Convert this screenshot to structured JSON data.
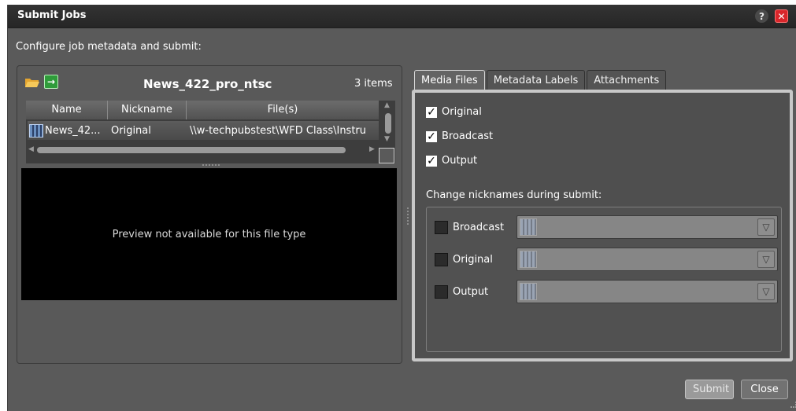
{
  "dialog": {
    "title": "Submit Jobs",
    "help_glyph": "?",
    "close_glyph": "✕",
    "subtitle": "Configure job metadata and submit:"
  },
  "left_panel": {
    "bin_name": "News_422_pro_ntsc",
    "item_count": "3 items",
    "columns": [
      "Name",
      "Nickname",
      "File(s)"
    ],
    "rows": [
      {
        "name": "News_42...",
        "nickname": "Original",
        "files": "\\\\w-techpubstest\\WFD Class\\Instru"
      }
    ],
    "preview_message": "Preview not available for this file type"
  },
  "tabs": [
    {
      "label": "Media Files",
      "active": true
    },
    {
      "label": "Metadata Labels",
      "active": false
    },
    {
      "label": "Attachments",
      "active": false
    }
  ],
  "media_files": {
    "checks": [
      {
        "label": "Original",
        "checked": true
      },
      {
        "label": "Broadcast",
        "checked": true
      },
      {
        "label": "Output",
        "checked": true
      }
    ],
    "nickname_section_label": "Change nicknames during submit:",
    "nickname_rows": [
      {
        "label": "Broadcast",
        "checked": false,
        "value": ""
      },
      {
        "label": "Original",
        "checked": false,
        "value": ""
      },
      {
        "label": "Output",
        "checked": false,
        "value": ""
      }
    ]
  },
  "buttons": {
    "submit": "Submit",
    "close": "Close"
  },
  "icons": {
    "folder": "folder-open-icon",
    "import": "import-arrow-icon",
    "file_thumb": "film-strip-icon",
    "help": "help-icon",
    "close": "close-icon",
    "dropdown": "chevron-down-icon"
  }
}
